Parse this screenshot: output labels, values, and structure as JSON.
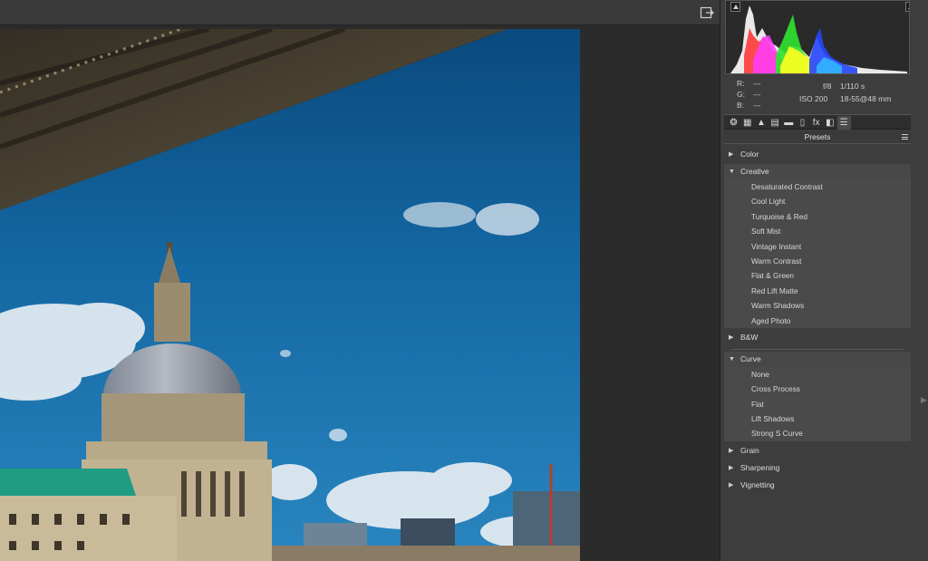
{
  "toolbar": {
    "exit_icon": "exit-fullscreen-icon"
  },
  "photo": {
    "subject": ""
  },
  "histogram": {
    "colors": [
      "#ffffff",
      "#ff2020",
      "#ff20ff",
      "#ffff00",
      "#20ff20",
      "#2040ff",
      "#20ffff"
    ]
  },
  "info": {
    "r_label": "R:",
    "r_value": "---",
    "g_label": "G:",
    "g_value": "---",
    "b_label": "B:",
    "b_value": "---",
    "aperture": "f/8",
    "shutter": "1/110 s",
    "iso": "ISO 200",
    "lens": "18-55@48 mm"
  },
  "tools": [
    {
      "name": "basic-icon",
      "glyph": "❂"
    },
    {
      "name": "tone-curve-icon",
      "glyph": "▦"
    },
    {
      "name": "detail-icon",
      "glyph": "▲"
    },
    {
      "name": "hsl-icon",
      "glyph": "▤"
    },
    {
      "name": "split-toning-icon",
      "glyph": "▬"
    },
    {
      "name": "lens-corrections-icon",
      "glyph": "▯"
    },
    {
      "name": "effects-icon",
      "glyph": "fx"
    },
    {
      "name": "camera-calibration-icon",
      "glyph": "◧"
    },
    {
      "name": "presets-icon",
      "glyph": "☰"
    }
  ],
  "presets": {
    "title": "Presets",
    "groups": [
      {
        "label": "Color",
        "open": false,
        "items": []
      },
      {
        "label": "Creative",
        "open": true,
        "items": [
          "Desaturated Contrast",
          "Cool Light",
          "Turquoise & Red",
          "Soft Mist",
          "Vintage Instant",
          "Warm Contrast",
          "Flat & Green",
          "Red Lift Matte",
          "Warm Shadows",
          "Aged Photo"
        ]
      },
      {
        "label": "B&W",
        "open": false,
        "items": []
      },
      {
        "label": "Curve",
        "open": true,
        "items": [
          "None",
          "Cross Process",
          "Flat",
          "Lift Shadows",
          "Strong S Curve"
        ]
      },
      {
        "label": "Grain",
        "open": false,
        "items": []
      },
      {
        "label": "Sharpening",
        "open": false,
        "items": []
      },
      {
        "label": "Vignetting",
        "open": false,
        "items": []
      }
    ]
  }
}
